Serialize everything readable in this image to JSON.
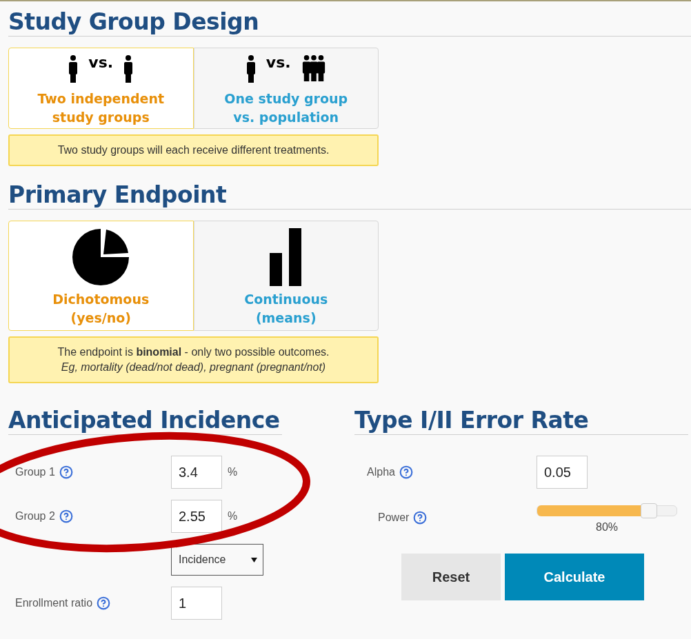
{
  "study_group_design": {
    "title": "Study Group Design",
    "options": [
      {
        "kind": "individuals",
        "vs": "vs.",
        "label": "Two independent study groups",
        "selected": true
      },
      {
        "kind": "population",
        "vs": "vs.",
        "label": "One study group vs. population",
        "selected": false
      }
    ],
    "note": [
      "Two study groups will each receive different treatments."
    ]
  },
  "primary_endpoint": {
    "title": "Primary Endpoint",
    "options": [
      {
        "kind": "pie",
        "label": "Dichotomous",
        "sublabel": "(yes/no)",
        "selected": true
      },
      {
        "kind": "bars",
        "label": "Continuous",
        "sublabel": "(means)",
        "selected": false
      }
    ],
    "note": [
      "The endpoint is **binomial** - only two possible outcomes.",
      "*Eg, mortality (dead/not dead), pregnant (pregnant/not)*"
    ]
  },
  "anticipated_incidence": {
    "title": "Anticipated Incidence",
    "fields": [
      {
        "kind": "number",
        "label": "Group 1",
        "value": "3.4",
        "unit": "%"
      },
      {
        "kind": "number",
        "label": "Group 2",
        "value": "2.55",
        "unit": "%"
      },
      {
        "kind": "select",
        "value": "Incidence"
      },
      {
        "kind": "number",
        "label": "Enrollment ratio",
        "value": "1"
      }
    ]
  },
  "error_rate": {
    "title": "Type I/II Error Rate",
    "fields": [
      {
        "kind": "number",
        "label": "Alpha",
        "value": "0.05"
      },
      {
        "kind": "slider",
        "label": "Power",
        "level": 0.8,
        "reading": "80%"
      }
    ]
  },
  "buttons": [
    {
      "kind": "secondary",
      "label": "Reset"
    },
    {
      "kind": "primary",
      "label": "Calculate"
    }
  ]
}
